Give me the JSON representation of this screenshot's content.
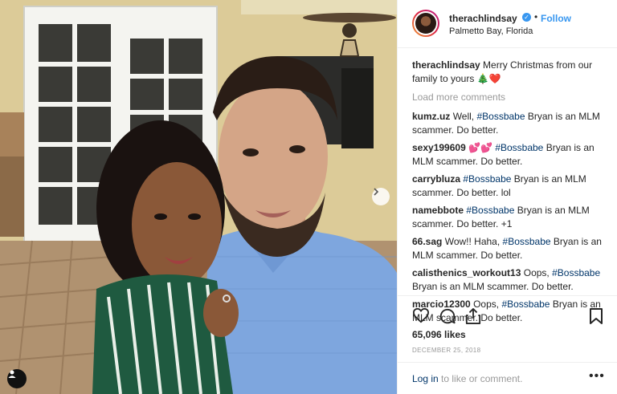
{
  "post": {
    "username": "therachlindsay",
    "follow_label": "Follow",
    "separator": "•",
    "location": "Palmetto Bay, Florida",
    "caption_user": "therachlindsay",
    "caption_text": "Merry Christmas from our family to yours",
    "caption_emoji": "🎄❤️",
    "load_more": "Load more comments",
    "likes": "65,096 likes",
    "date": "DECEMBER 25, 2018"
  },
  "comments": [
    {
      "user": "kumz.uz",
      "pre": "Well, ",
      "tag": "#Bossbabe",
      "post": " Bryan is an MLM scammer. Do better."
    },
    {
      "user": "sexy199609",
      "pre": "💕💕 ",
      "tag": "#Bossbabe",
      "post": " Bryan is an MLM scammer. Do better."
    },
    {
      "user": "carrybluza",
      "pre": "",
      "tag": "#Bossbabe",
      "post": " Bryan is an MLM scammer. Do better. lol"
    },
    {
      "user": "namebbote",
      "pre": "",
      "tag": "#Bossbabe",
      "post": " Bryan is an MLM scammer. Do better. +1"
    },
    {
      "user": "66.sag",
      "pre": "Wow!! Haha, ",
      "tag": "#Bossbabe",
      "post": " Bryan is an MLM scammer. Do better."
    },
    {
      "user": "calisthenics_workout13",
      "pre": "Oops, ",
      "tag": "#Bossbabe",
      "post": " Bryan is an MLM scammer. Do better."
    },
    {
      "user": "marcio12300",
      "pre": "Oops, ",
      "tag": "#Bossbabe",
      "post": " Bryan is an MLM scammer. Do better."
    }
  ],
  "footer": {
    "login_link": "Log in",
    "login_rest": " to like or comment.",
    "more": "•••"
  },
  "icons": {
    "verified": "verified-badge-icon",
    "like": "heart-icon",
    "comment": "comment-bubble-icon",
    "share": "share-icon",
    "save": "bookmark-icon",
    "next": "chevron-right-icon",
    "tag": "user-tag-icon"
  },
  "colors": {
    "accent": "#3897f0",
    "hashtag": "#003569",
    "muted": "#999999"
  }
}
